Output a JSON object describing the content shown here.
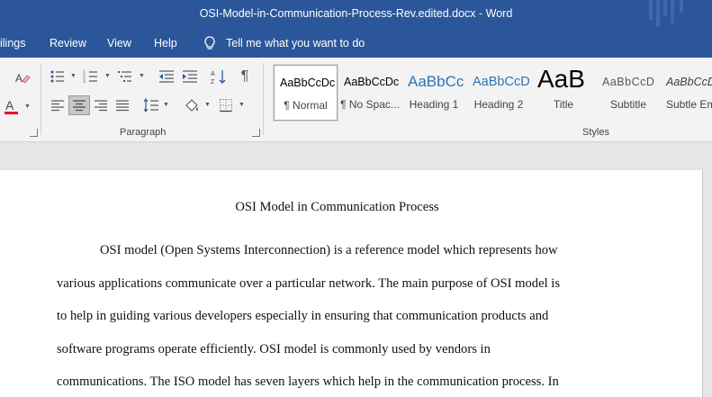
{
  "window": {
    "title": "OSI-Model-in-Communication-Process-Rev.edited.docx  -  Word"
  },
  "menu": {
    "items": [
      "ilings",
      "Review",
      "View",
      "Help"
    ],
    "tell_me": "Tell me what you want to do"
  },
  "ribbon": {
    "paragraph_label": "Paragraph",
    "styles_label": "Styles",
    "styles": [
      {
        "sample": "AaBbCcDc",
        "name": "¶ Normal",
        "color": "#000000"
      },
      {
        "sample": "AaBbCcDc",
        "name": "¶ No Spac...",
        "color": "#000000"
      },
      {
        "sample": "AaBbCc",
        "name": "Heading 1",
        "color": "#2e74b5"
      },
      {
        "sample": "AaBbCcD",
        "name": "Heading 2",
        "color": "#2e74b5"
      },
      {
        "sample": "AaB",
        "name": "Title",
        "color": "#000000"
      },
      {
        "sample": "AaBbCcD",
        "name": "Subtitle",
        "color": "#595959"
      },
      {
        "sample": "AaBbCcD",
        "name": "Subtle Em",
        "color": "#404040"
      }
    ],
    "icons": {
      "clear_formatting": "eraser-icon",
      "font_color": "font-color-icon",
      "font_color_value": "#e81123"
    }
  },
  "document": {
    "title": "OSI Model in Communication Process",
    "lines": [
      "OSI model (Open Systems Interconnection) is a reference model which represents how",
      "various applications communicate over a particular network. The main purpose of OSI model is",
      "to help in guiding various developers especially in ensuring that communication products and",
      "software programs operate efficiently. OSI model is commonly used by vendors in",
      "communications. The ISO model has seven layers which help in the communication process. In"
    ]
  },
  "theme": {
    "accent": "#2b579a"
  }
}
